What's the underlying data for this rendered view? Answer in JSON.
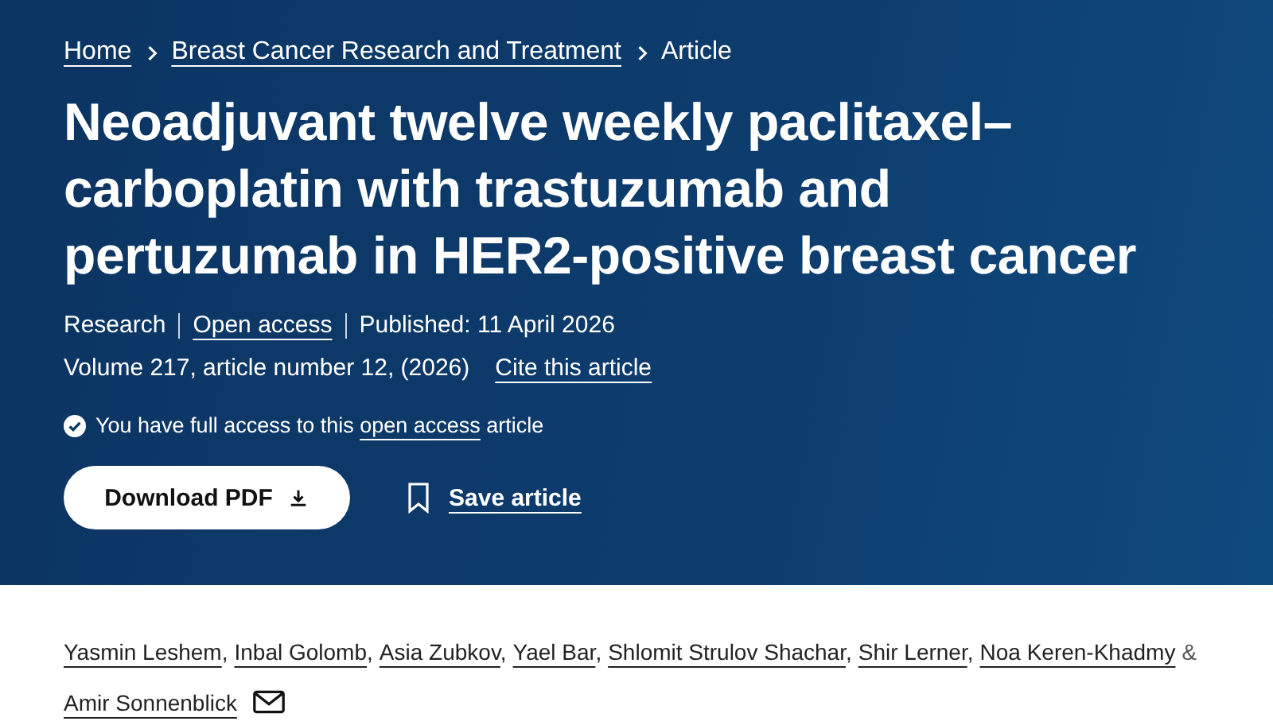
{
  "breadcrumbs": [
    {
      "label": "Home"
    },
    {
      "label": "Breast Cancer Research and Treatment"
    },
    {
      "label": "Article"
    }
  ],
  "title": "Neoadjuvant twelve weekly paclitaxel–carboplatin with trastuzumab and pertuzumab in HER2-positive breast cancer",
  "meta": [
    {
      "kind": "text",
      "label": "Research"
    },
    {
      "kind": "link",
      "label": "Open access"
    },
    {
      "kind": "text",
      "label": "Published: 11 April 2026"
    }
  ],
  "citation": {
    "text": "Volume 217, article number 12, (2026)",
    "link": "Cite this article"
  },
  "access_notice": {
    "before": "You have full access to this",
    "link": "open access",
    "after": "article"
  },
  "actions": {
    "download": "Download PDF",
    "save": "Save article"
  },
  "authors": [
    {
      "name": "Yasmin Leshem",
      "after": ","
    },
    {
      "name": "Inbal Golomb",
      "after": ","
    },
    {
      "name": "Asia Zubkov",
      "after": ","
    },
    {
      "name": "Yael Bar",
      "after": ","
    },
    {
      "name": "Shlomit Strulov Shachar",
      "after": ","
    },
    {
      "name": "Shir Lerner",
      "after": ","
    },
    {
      "name": "Noa Keren-Khadmy",
      "after": "&"
    },
    {
      "name": "Amir Sonnenblick"
    }
  ]
}
